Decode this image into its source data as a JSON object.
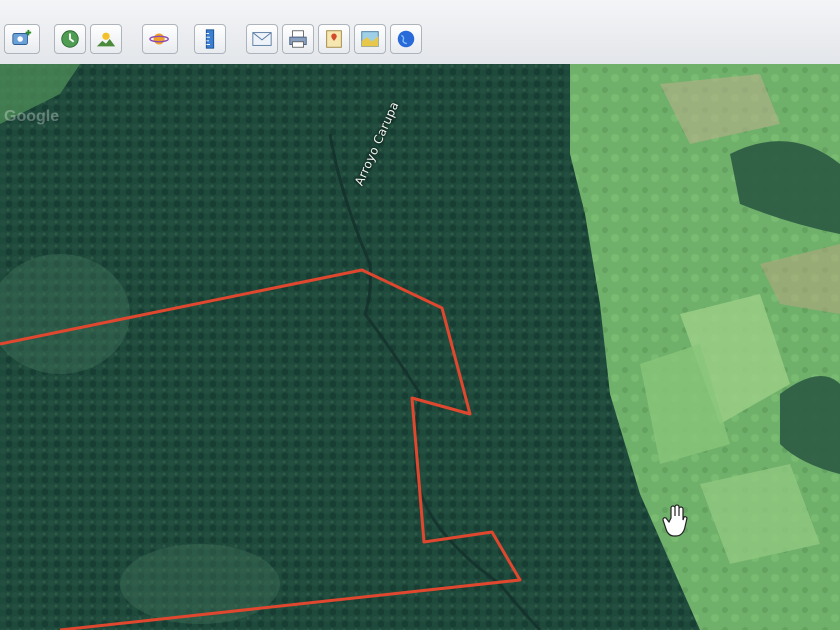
{
  "toolbar": {
    "buttons": [
      {
        "name": "add-placemark-button",
        "icon": "placemark-add-icon"
      },
      {
        "name": "history-button",
        "icon": "clock-globe-icon"
      },
      {
        "name": "sunlight-button",
        "icon": "sun-landscape-icon"
      },
      {
        "name": "planet-button",
        "icon": "planet-icon"
      },
      {
        "name": "ruler-button",
        "icon": "ruler-icon"
      },
      {
        "name": "email-button",
        "icon": "envelope-icon"
      },
      {
        "name": "print-button",
        "icon": "printer-icon"
      },
      {
        "name": "save-image-button",
        "icon": "image-save-icon"
      },
      {
        "name": "view-maps-button",
        "icon": "map-icon"
      },
      {
        "name": "earth-button",
        "icon": "globe-icon"
      }
    ]
  },
  "map": {
    "river_label": "Arroyo Carupa",
    "watermark": "Google",
    "watermark_sub": "",
    "boundary_color": "#e0472f",
    "forest_color": "#1e4a3c",
    "pasture_color": "#6fb06a"
  }
}
